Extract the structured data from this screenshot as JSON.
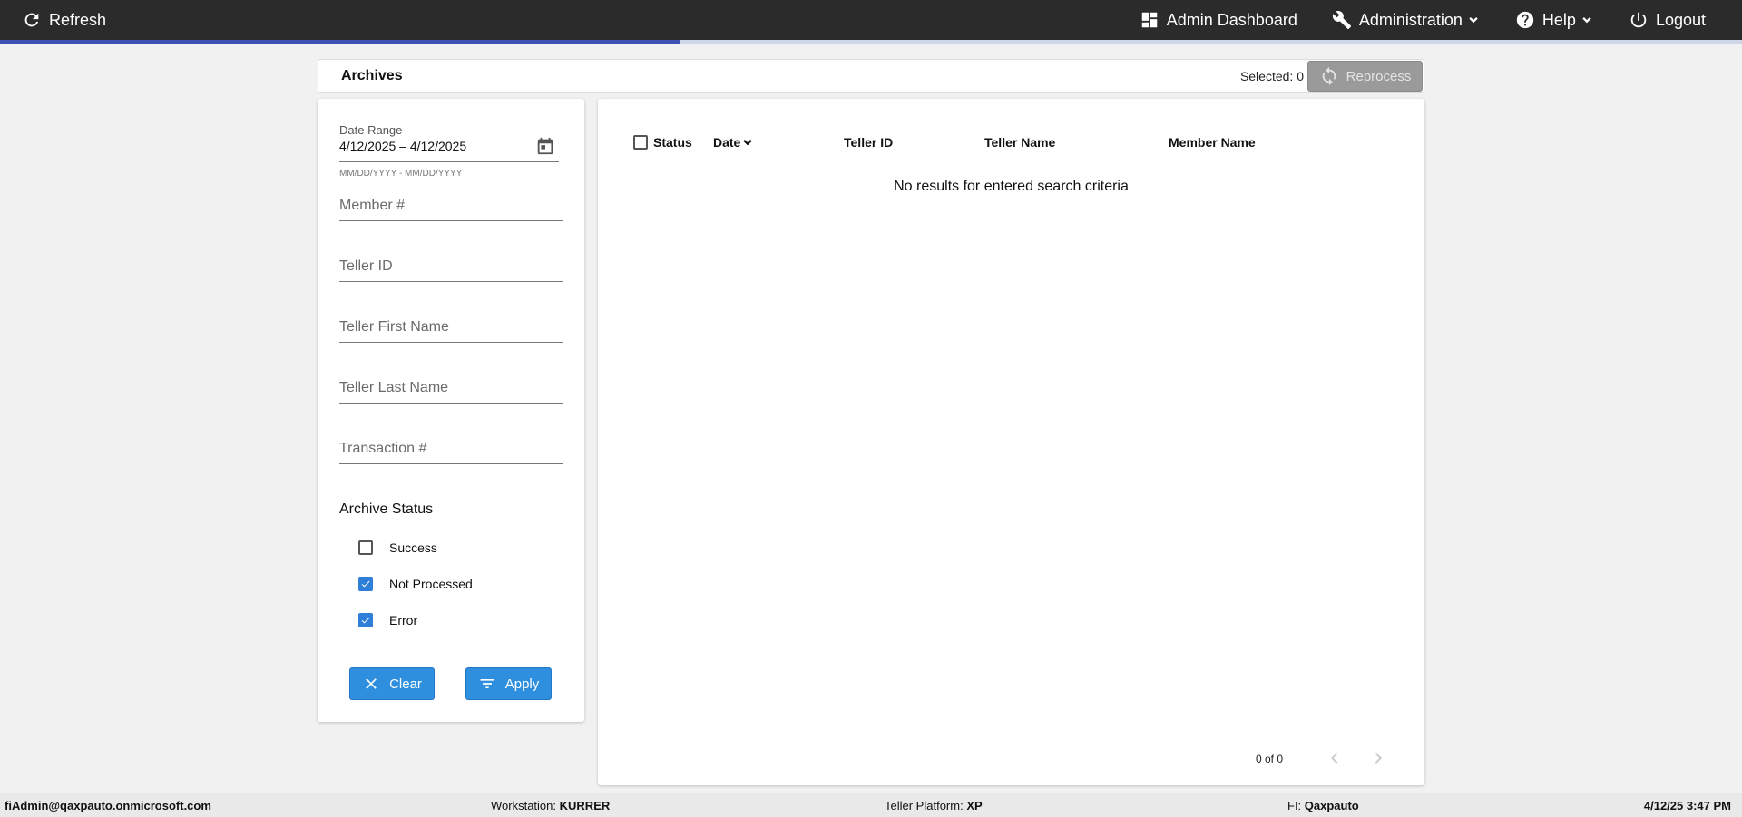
{
  "topbar": {
    "refresh_label": "Refresh",
    "admin_dashboard_label": "Admin Dashboard",
    "administration_label": "Administration",
    "help_label": "Help",
    "logout_label": "Logout",
    "load_progress": 0.39,
    "accent_color": "#3f51b5"
  },
  "header": {
    "title": "Archives",
    "selected_text": "Selected: 0",
    "reprocess_label": "Reprocess"
  },
  "filters": {
    "date_range_label": "Date Range",
    "date_range_value": "4/12/2025 – 4/12/2025",
    "date_range_hint": "MM/DD/YYYY - MM/DD/YYYY",
    "member_placeholder": "Member #",
    "teller_id_placeholder": "Teller ID",
    "teller_first_placeholder": "Teller First Name",
    "teller_last_placeholder": "Teller Last Name",
    "transaction_placeholder": "Transaction #",
    "archive_status_title": "Archive Status",
    "status_options": [
      {
        "label": "Success",
        "checked": false
      },
      {
        "label": "Not Processed",
        "checked": true
      },
      {
        "label": "Error",
        "checked": true
      }
    ],
    "clear_label": "Clear",
    "apply_label": "Apply"
  },
  "table": {
    "columns": [
      "Status",
      "Date",
      "Teller ID",
      "Teller Name",
      "Member Name"
    ],
    "empty_message": "No results for entered search criteria",
    "pager_text": "0 of 0"
  },
  "statusbar": {
    "user": "fiAdmin@qaxpauto.onmicrosoft.com",
    "workstation_label": "Workstation:",
    "workstation_value": "KURRER",
    "platform_label": "Teller Platform:",
    "platform_value": "XP",
    "fi_label": "FI:",
    "fi_value": "Qaxpauto",
    "datetime": "4/12/25 3:47 PM"
  }
}
